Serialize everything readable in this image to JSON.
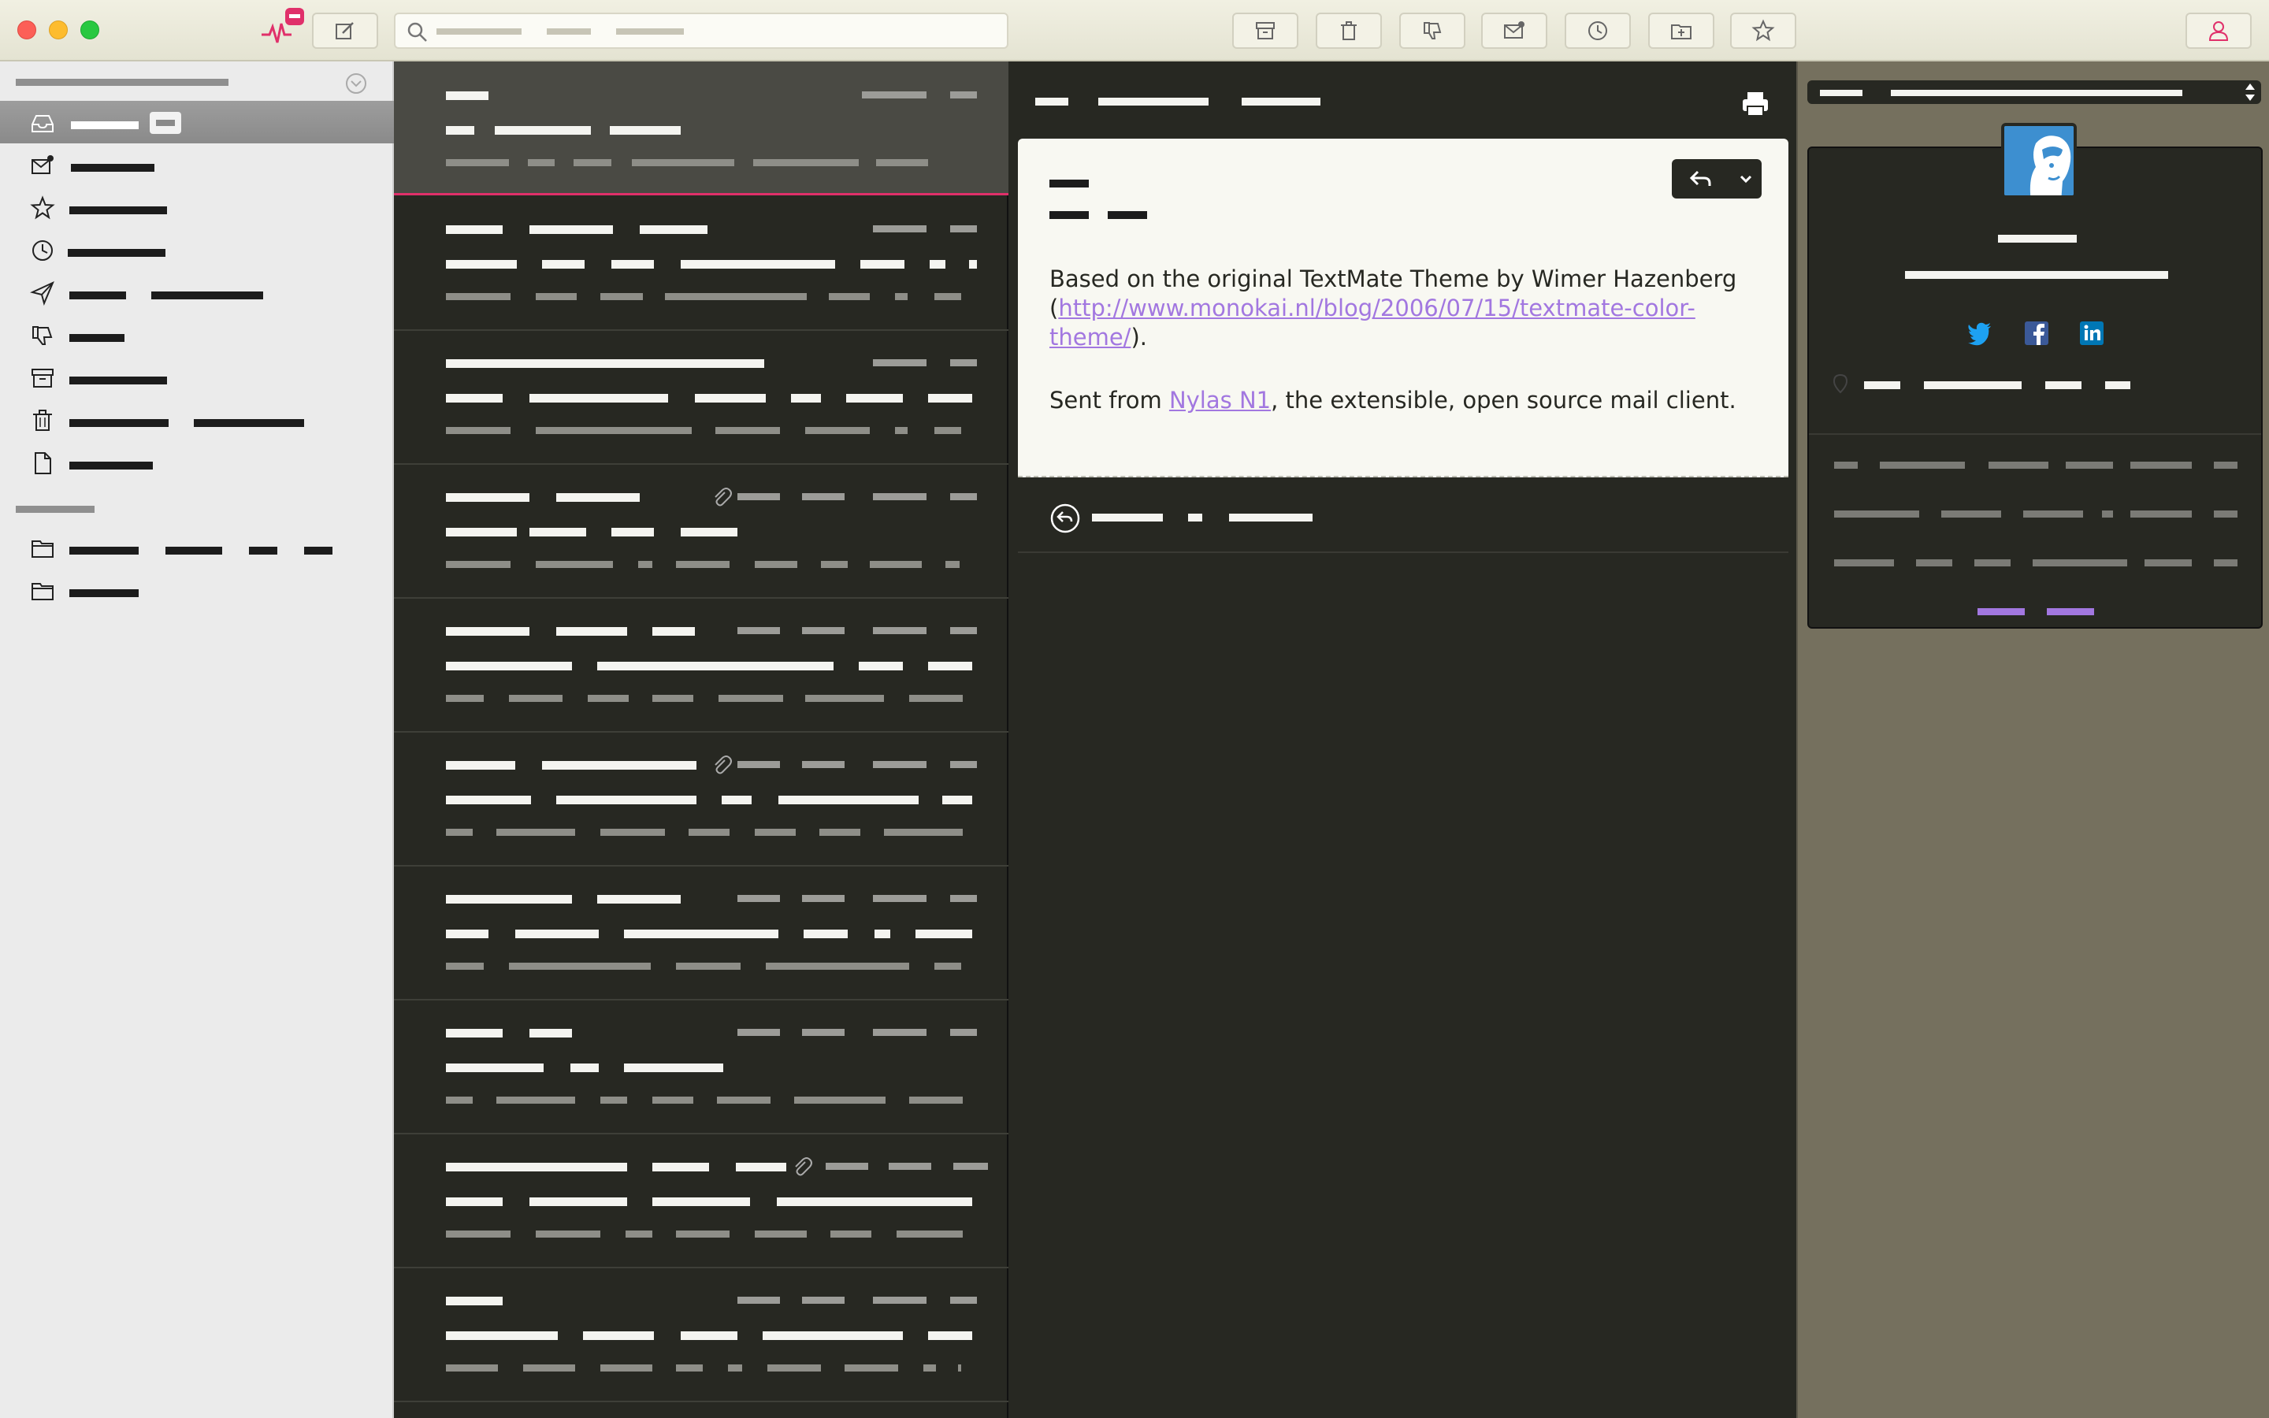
{
  "app": {
    "unread_badge": ""
  },
  "toolbar": {
    "buttons": [
      "compose-icon",
      "archive-icon",
      "trash-icon",
      "thumbs-down-icon",
      "mark-icon",
      "clock-icon",
      "folder-move-icon",
      "star-icon",
      "account-icon"
    ],
    "search": {
      "placeholder": ""
    }
  },
  "sidebar": {
    "section_header": "",
    "items": [
      {
        "icon": "inbox-icon",
        "label": ""
      },
      {
        "icon": "envelope-icon",
        "label": ""
      },
      {
        "icon": "star-icon",
        "label": ""
      },
      {
        "icon": "clock-icon",
        "label": ""
      },
      {
        "icon": "paper-plane-icon",
        "label": ""
      },
      {
        "icon": "thumbs-down-icon",
        "label": ""
      },
      {
        "icon": "archive-icon",
        "label": ""
      },
      {
        "icon": "trash-icon",
        "label": ""
      },
      {
        "icon": "document-icon",
        "label": ""
      }
    ],
    "folders_header": "",
    "folders": [
      {
        "icon": "folder-icon",
        "label": ""
      },
      {
        "icon": "folder-icon",
        "label": ""
      }
    ]
  },
  "threads": {
    "count_visible": 10
  },
  "message": {
    "subject": "",
    "body_line1": "Based on the original TextMate Theme by Wimer Hazenberg",
    "body_paren_open": "(",
    "body_link": "http://www.monokai.nl/blog/2006/07/15/textmate-color-theme/",
    "body_paren_close": ").",
    "sent_prefix": "Sent from ",
    "sent_link": "Nylas N1",
    "sent_suffix": ", the extensible, open source mail client."
  },
  "contact": {
    "social": [
      "twitter-icon",
      "facebook-icon",
      "linkedin-icon"
    ],
    "colors": {
      "accent": "#a277e0",
      "brand": "#e0306a",
      "twitter": "#1da1f2",
      "facebook": "#3b5998",
      "linkedin": "#0077b5"
    }
  }
}
